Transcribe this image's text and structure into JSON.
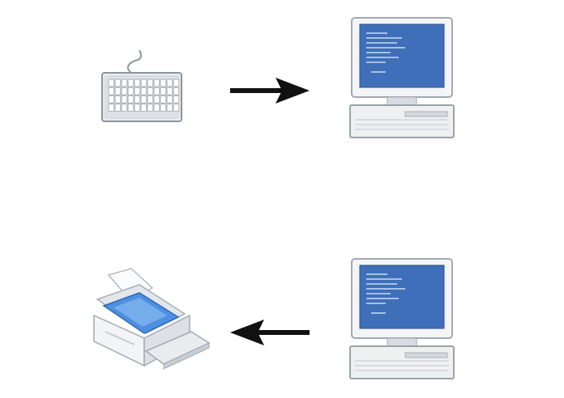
{
  "diagram": {
    "nodes": [
      {
        "id": "keyboard",
        "icon": "keyboard-icon"
      },
      {
        "id": "computer-top",
        "icon": "computer-icon"
      },
      {
        "id": "computer-bottom",
        "icon": "computer-icon"
      },
      {
        "id": "printer",
        "icon": "printer-icon"
      }
    ],
    "edges": [
      {
        "from": "keyboard",
        "to": "computer-top"
      },
      {
        "from": "computer-bottom",
        "to": "printer"
      }
    ]
  },
  "colors": {
    "screen_blue": "#3f6fb8",
    "arrow": "#111111",
    "printer_tray_blue": "#4d8fe0",
    "case_light": "#eef0f2",
    "case_stroke": "#9aa2ab"
  }
}
